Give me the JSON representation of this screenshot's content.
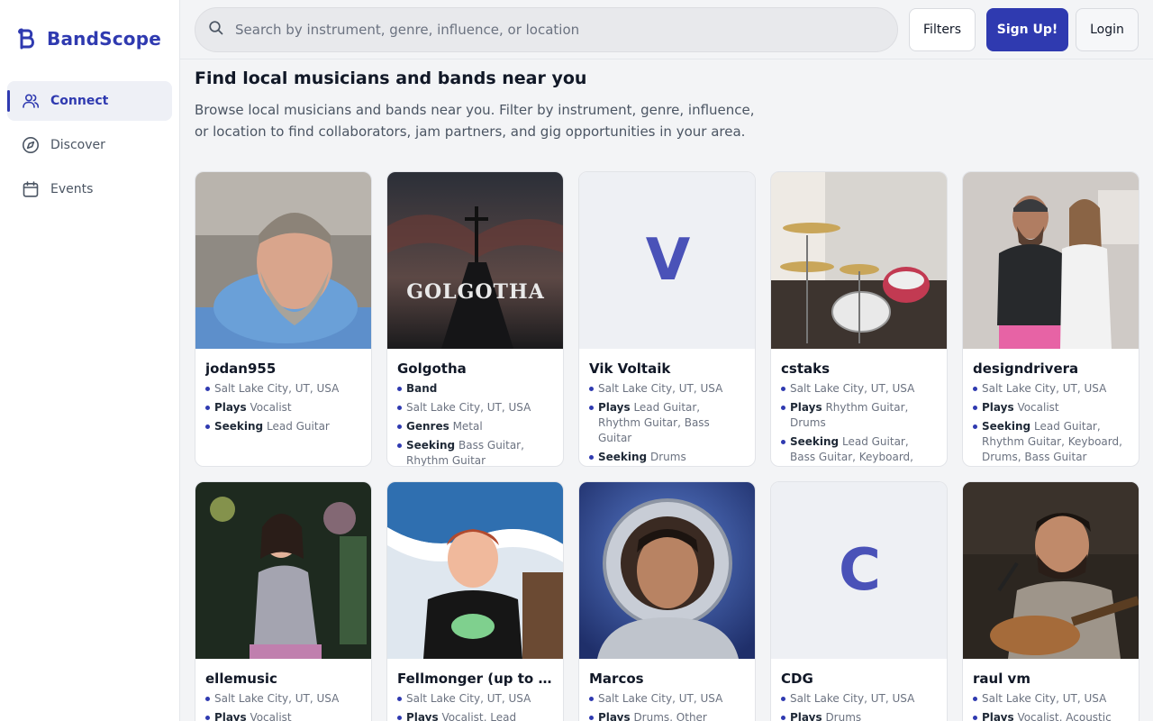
{
  "brand": {
    "name": "BandScope"
  },
  "nav": [
    {
      "label": "Connect",
      "icon": "users-icon",
      "active": true
    },
    {
      "label": "Discover",
      "icon": "compass-icon",
      "active": false
    },
    {
      "label": "Events",
      "icon": "calendar-icon",
      "active": false
    }
  ],
  "search": {
    "placeholder": "Search by instrument, genre, influence, or location"
  },
  "buttons": {
    "filters": "Filters",
    "signup": "Sign Up!",
    "login": "Login"
  },
  "page": {
    "title": "Find local musicians and bands near you",
    "description": "Browse local musicians and bands near you. Filter by instrument, genre, influence, or location to find collaborators, jam partners, and gig opportunities in your area."
  },
  "colors": {
    "accent": "#2f3ab0",
    "background": "#f3f4f6"
  },
  "cards": [
    {
      "name": "jodan955",
      "location": "Salt Lake City, UT, USA",
      "plays_label": "Plays",
      "plays": "Vocalist",
      "seeking_label": "Seeking",
      "seeking": "Lead Guitar"
    },
    {
      "name": "Golgotha",
      "type": "Band",
      "location": "Salt Lake City, UT, USA",
      "genres_label": "Genres",
      "genres": "Metal",
      "seeking_label": "Seeking",
      "seeking": "Bass Guitar, Rhythm Guitar",
      "image_text": "GOLGOTHA"
    },
    {
      "name": "Vik Voltaik",
      "initial": "V",
      "location": "Salt Lake City, UT, USA",
      "plays_label": "Plays",
      "plays": "Lead Guitar, Rhythm Guitar, Bass Guitar",
      "seeking_label": "Seeking",
      "seeking": "Drums"
    },
    {
      "name": "cstaks",
      "location": "Salt Lake City, UT, USA",
      "plays_label": "Plays",
      "plays": "Rhythm Guitar, Drums",
      "seeking_label": "Seeking",
      "seeking": "Lead Guitar, Bass Guitar, Keyboard, Piano"
    },
    {
      "name": "designdrivera",
      "location": "Salt Lake City, UT, USA",
      "plays_label": "Plays",
      "plays": "Vocalist",
      "seeking_label": "Seeking",
      "seeking": "Lead Guitar, Rhythm Guitar, Keyboard, Drums, Bass Guitar"
    },
    {
      "name": "ellemusic",
      "location": "Salt Lake City, UT, USA",
      "plays_label": "Plays",
      "plays": "Vocalist"
    },
    {
      "name": "Fellmonger (up to ch...",
      "location": "Salt Lake City, UT, USA",
      "plays_label": "Plays",
      "plays": "Vocalist, Lead Guitar"
    },
    {
      "name": "Marcos",
      "location": "Salt Lake City, UT, USA",
      "plays_label": "Plays",
      "plays": "Drums, Other"
    },
    {
      "name": "CDG",
      "initial": "C",
      "location": "Salt Lake City, UT, USA",
      "plays_label": "Plays",
      "plays": "Drums"
    },
    {
      "name": "raul vm",
      "location": "Salt Lake City, UT, USA",
      "plays_label": "Plays",
      "plays": "Vocalist, Acoustic"
    }
  ]
}
